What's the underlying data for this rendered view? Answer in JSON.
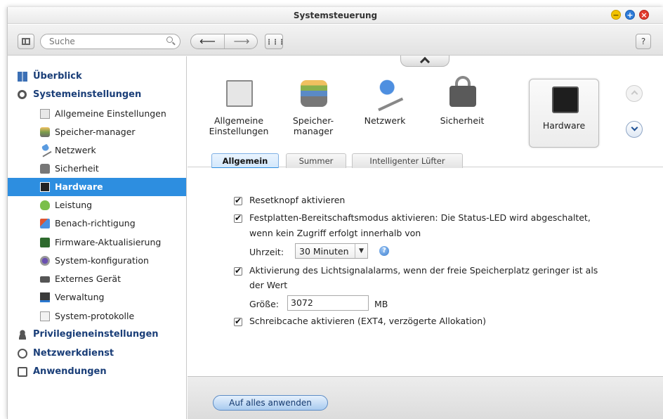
{
  "window": {
    "title": "Systemsteuerung",
    "buttons": {
      "minimize": "−",
      "maximize": "+",
      "close": "×"
    }
  },
  "toolbar": {
    "search_placeholder": "Suche",
    "help_label": "?",
    "back_label": "⟵",
    "forward_label": "⟶",
    "grid_label": "⋮⋮⋮"
  },
  "sidebar": {
    "sections": [
      {
        "label": "Überblick",
        "icon": "overview-icon"
      },
      {
        "label": "Systemeinstellungen",
        "icon": "gear-icon"
      },
      {
        "label": "Privilegieneinstellungen",
        "icon": "user-icon"
      },
      {
        "label": "Netzwerkdienst",
        "icon": "network-service-icon"
      },
      {
        "label": "Anwendungen",
        "icon": "apps-icon"
      }
    ],
    "items": [
      {
        "label": "Allgemeine Einstellungen",
        "icon": "settings-doc-icon"
      },
      {
        "label": "Speicher-manager",
        "icon": "storage-icon"
      },
      {
        "label": "Netzwerk",
        "icon": "network-icon"
      },
      {
        "label": "Sicherheit",
        "icon": "lock-icon"
      },
      {
        "label": "Hardware",
        "icon": "hardware-icon",
        "active": true
      },
      {
        "label": "Leistung",
        "icon": "performance-icon"
      },
      {
        "label": "Benach-richtigung",
        "icon": "notification-icon"
      },
      {
        "label": "Firmware-Aktualisierung",
        "icon": "firmware-icon"
      },
      {
        "label": "System-konfiguration",
        "icon": "system-config-icon"
      },
      {
        "label": "Externes Gerät",
        "icon": "external-device-icon"
      },
      {
        "label": "Verwaltung",
        "icon": "admin-icon"
      },
      {
        "label": "System-protokolle",
        "icon": "log-icon"
      }
    ]
  },
  "categories": [
    {
      "label": "Allgemeine\nEinstellungen",
      "line1": "Allgemeine",
      "line2": "Einstellungen",
      "icon": "general-settings-icon"
    },
    {
      "label": "Speicher-\nmanager",
      "line1": "Speicher-",
      "line2": "manager",
      "icon": "storage-icon"
    },
    {
      "label": "Netzwerk",
      "line1": "Netzwerk",
      "line2": "",
      "icon": "network-icon"
    },
    {
      "label": "Sicherheit",
      "line1": "Sicherheit",
      "line2": "",
      "icon": "lock-icon"
    },
    {
      "label": "Hardware",
      "line1": "Hardware",
      "line2": "",
      "icon": "hardware-icon",
      "selected": true
    }
  ],
  "tabs": [
    {
      "label": "Allgemein",
      "active": true
    },
    {
      "label": "Summer"
    },
    {
      "label": "Intelligenter Lüfter"
    }
  ],
  "settings": {
    "reset_button": {
      "label": "Resetknopf aktivieren",
      "checked": true
    },
    "standby": {
      "label_line1": "Festplatten-Bereitschaftsmodus aktivieren: Die Status-LED wird abgeschaltet,",
      "label_line2": "wenn kein Zugriff erfolgt innerhalb von",
      "checked": true,
      "time_label": "Uhrzeit:",
      "time_value": "30 Minuten"
    },
    "light_alarm": {
      "label_line1": "Aktivierung des Lichtsignalalarms, wenn der freie Speicherplatz geringer ist als",
      "label_line2": "der Wert",
      "checked": true,
      "size_label": "Größe:",
      "size_value": "3072",
      "size_unit": "MB"
    },
    "write_cache": {
      "label": "Schreibcache aktivieren (EXT4, verzögerte Allokation)",
      "checked": true
    }
  },
  "footer": {
    "apply_label": "Auf alles anwenden"
  },
  "colors": {
    "accent": "#2d8ee0",
    "sidebar_heading": "#1a3e78",
    "apply_button_text": "#14396e"
  }
}
